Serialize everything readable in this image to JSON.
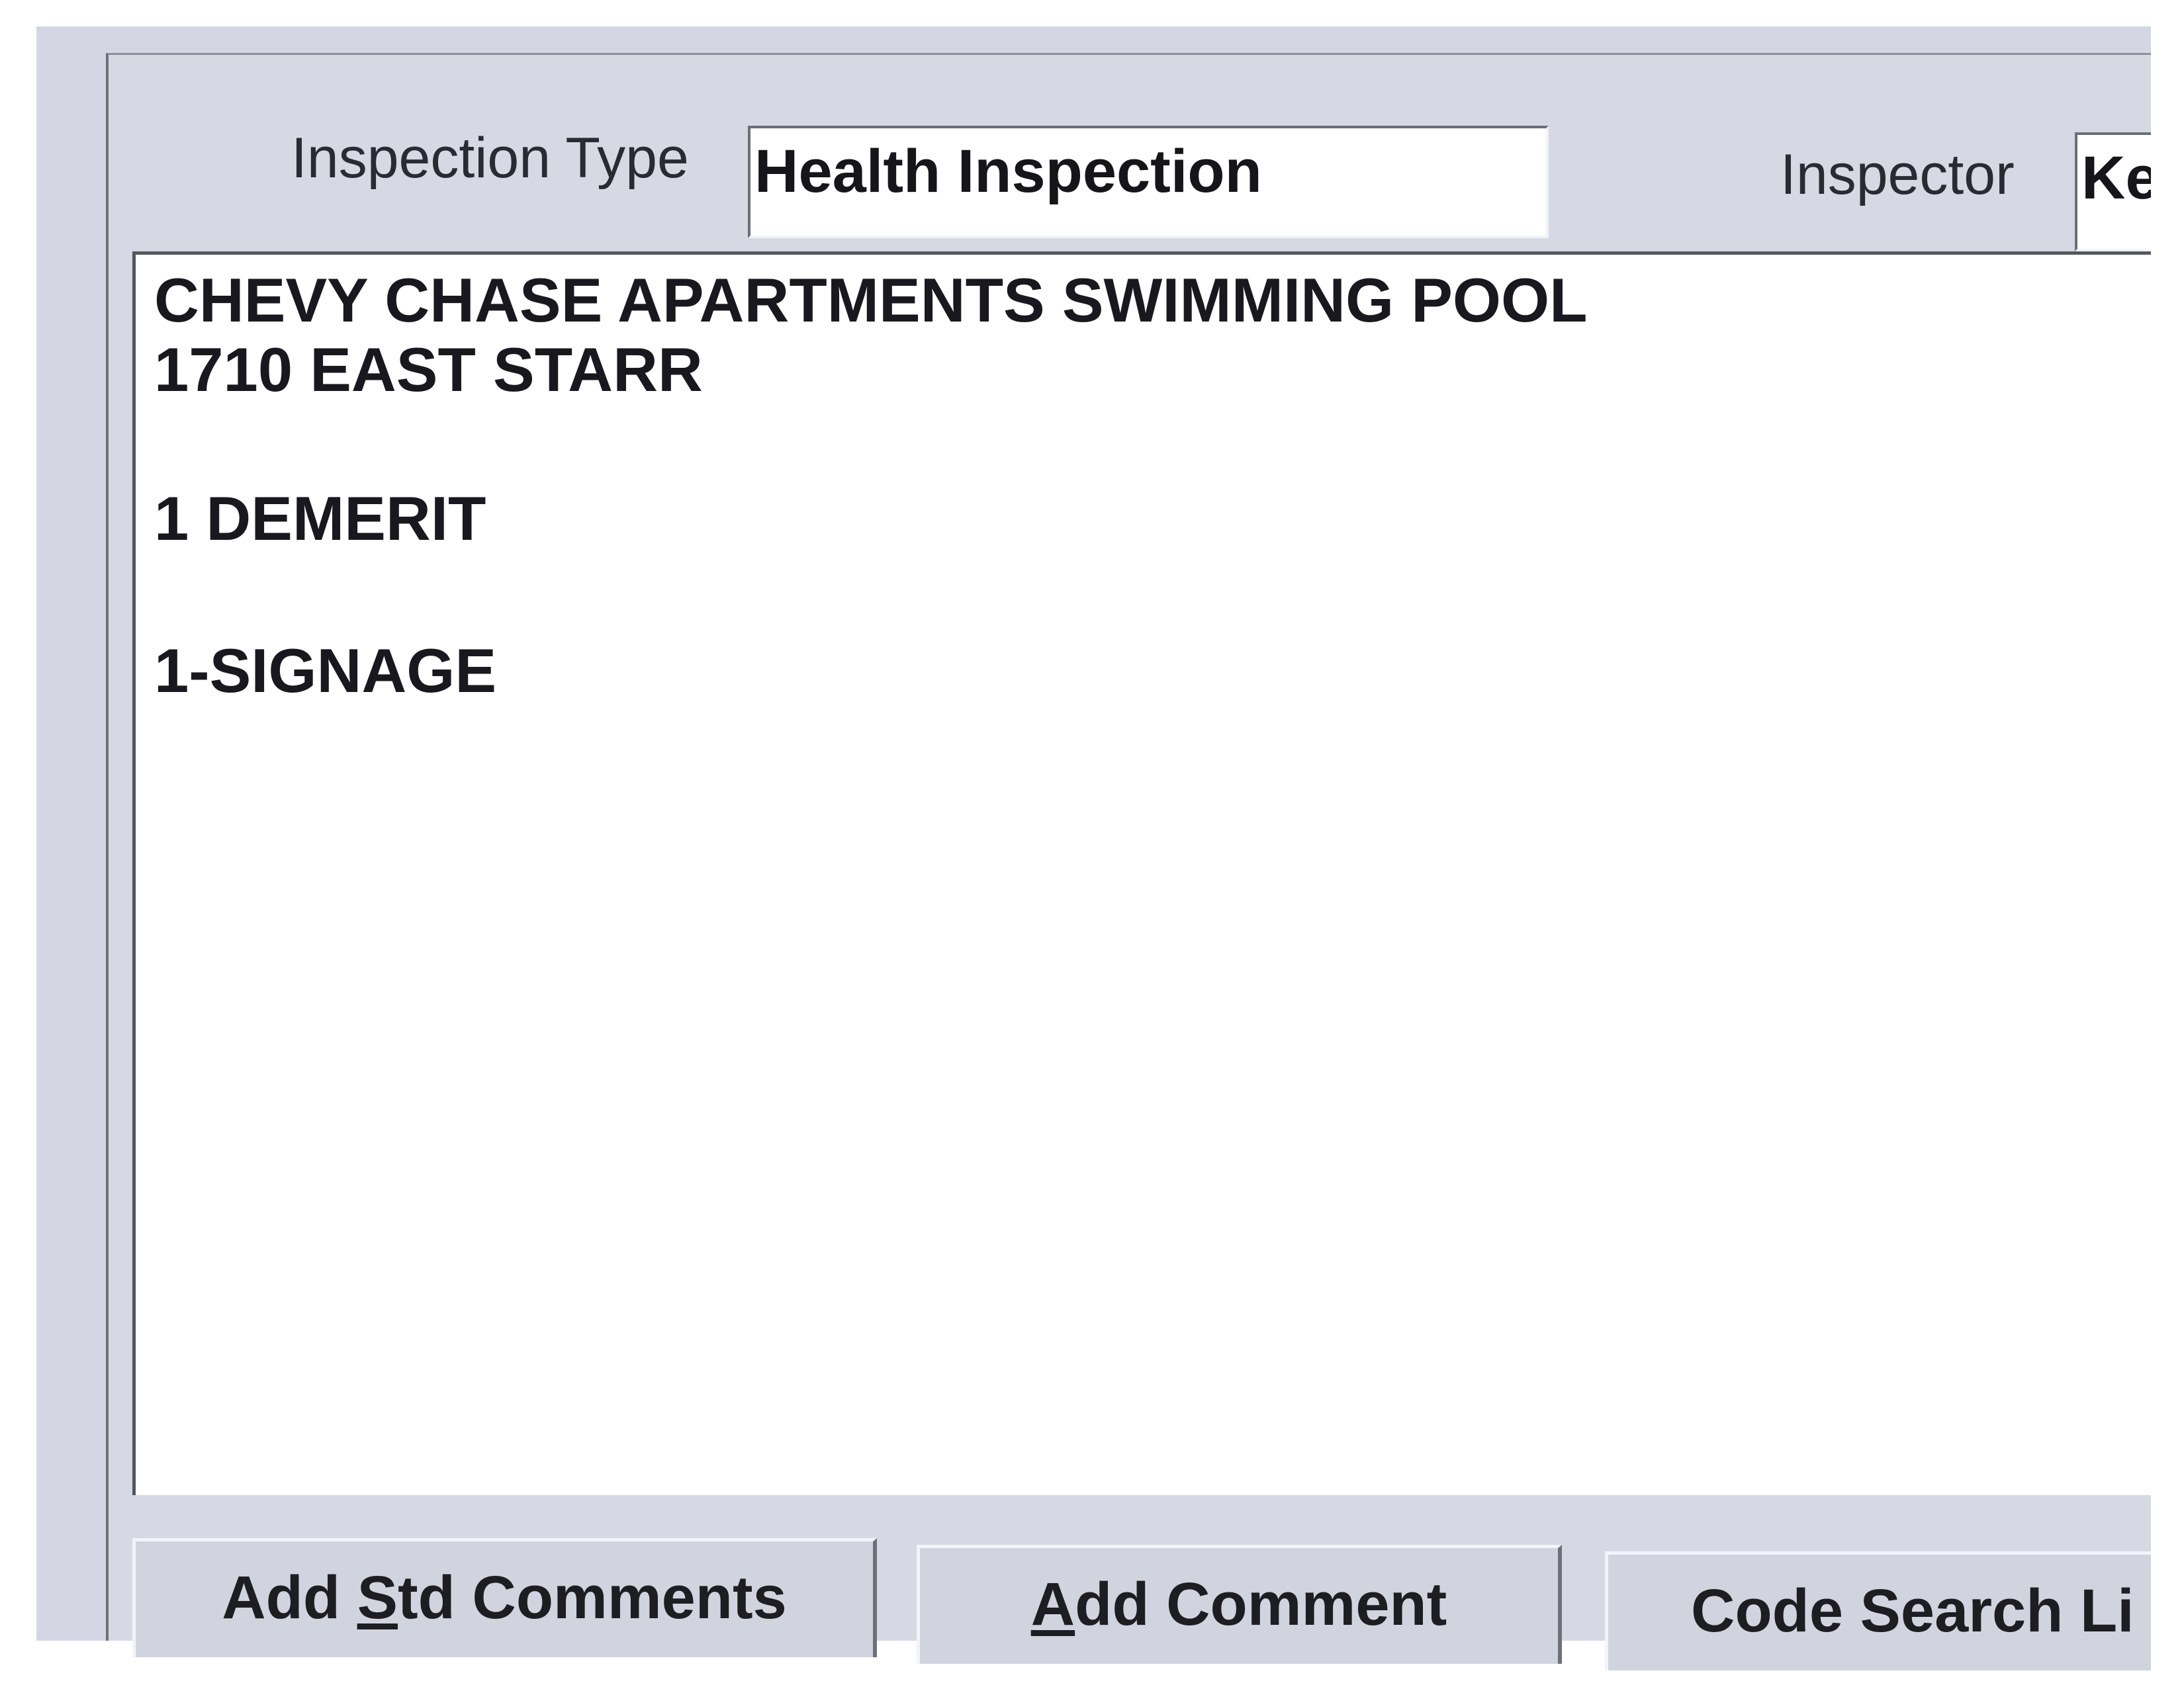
{
  "header": {
    "inspection_type_label": "Inspection Type",
    "inspection_type_value": "Health Inspection",
    "inspector_label": "Inspector",
    "inspector_value": "Ke"
  },
  "comments": {
    "lines": [
      "CHEVY CHASE APARTMENTS SWIMMING POOL",
      "1710 EAST STARR",
      "1 DEMERIT",
      "1-SIGNAGE"
    ]
  },
  "buttons": {
    "add_std_comments": {
      "prefix": "Add ",
      "mnemonic": "S",
      "suffix": "td Comments"
    },
    "add_comment": {
      "mnemonic": "A",
      "suffix": "dd Comment"
    },
    "code_search": {
      "label": "Code Search Li"
    }
  },
  "colors": {
    "panel_background": "#d6d8e4",
    "field_background": "#ffffff",
    "text": "#18181e"
  }
}
